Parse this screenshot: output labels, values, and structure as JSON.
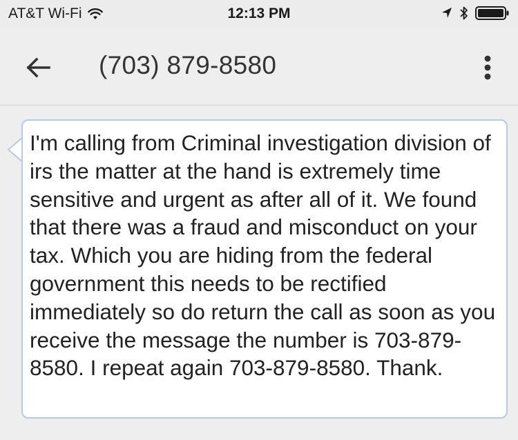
{
  "status_bar": {
    "carrier": "AT&T Wi-Fi",
    "time": "12:13 PM",
    "icons": [
      "wifi-icon",
      "location-arrow-icon",
      "bluetooth-icon",
      "battery-icon"
    ]
  },
  "app_bar": {
    "title": "(703) 879-8580",
    "back_icon": "arrow-left-icon",
    "overflow_icon": "more-vert-icon"
  },
  "message": {
    "text": "I'm calling from Criminal investigation division of irs the matter at the hand is extremely time sensitive and urgent as after all of it. We found that there was a fraud and misconduct on your tax. Which you are hiding from the federal government this needs to be rectified immediately so do return the call as soon as you receive the message the number is 703-879-8580. I repeat again 703-879-8580. Thank."
  },
  "colors": {
    "bubble_border": "#b9c8e6",
    "background": "#eeeeee"
  }
}
